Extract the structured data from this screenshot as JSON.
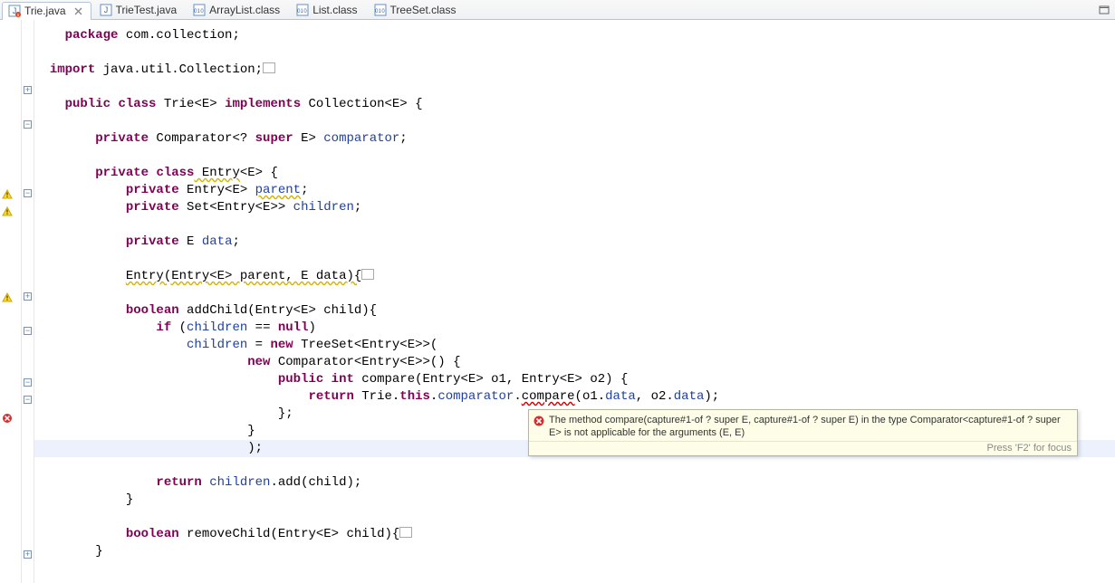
{
  "tabs": [
    {
      "label": "Trie.java",
      "icon": "java-error",
      "active": true
    },
    {
      "label": "TrieTest.java",
      "icon": "java",
      "active": false
    },
    {
      "label": "ArrayList.class",
      "icon": "class",
      "active": false
    },
    {
      "label": "List.class",
      "icon": "class",
      "active": false
    },
    {
      "label": "TreeSet.class",
      "icon": "class",
      "active": false
    }
  ],
  "hover": {
    "message": "The method compare(capture#1-of ? super E, capture#1-of ? super E) in the type Comparator<capture#1-of ? super E> is not applicable for the arguments (E, E)",
    "footer": "Press 'F2' for focus"
  },
  "code": {
    "l1_kw_package": "package",
    "l1_rest": " com.collection;",
    "l3_kw_import": "import",
    "l3_rest": " java.util.Collection;",
    "l5_kw_pub": "public",
    "l5_kw_cls": "class",
    "l5_name": " Trie<E> ",
    "l5_kw_impl": "implements",
    "l5_rest": " Collection<E> {",
    "l7_kw_priv": "private",
    "l7_rest1": " Comparator<? ",
    "l7_kw_sup": "super",
    "l7_rest2": " E> ",
    "l7_fld": "comparator",
    "l7_semi": ";",
    "l9_kw_priv": "private",
    "l9_kw_cls": "class",
    "l9_name": " Entry",
    "l9_rest": "<E> {",
    "l10_kw_priv": "private",
    "l10_rest": " Entry<E> ",
    "l10_fld": "parent",
    "l10_semi": ";",
    "l11_kw_priv": "private",
    "l11_rest": " Set<Entry<E>> ",
    "l11_fld": "children",
    "l11_semi": ";",
    "l13_kw_priv": "private",
    "l13_rest": " E ",
    "l13_fld": "data",
    "l13_semi": ";",
    "l15_name": "Entry",
    "l15_sig": "(Entry<E> parent, E data){",
    "l17_kw_bool": "boolean",
    "l17_rest": " addChild(Entry<E> child){",
    "l18_kw_if": "if",
    "l18_rest1": " (",
    "l18_fld": "children",
    "l18_rest2": " == ",
    "l18_kw_null": "null",
    "l18_rest3": ")",
    "l19_fld": "children",
    "l19_rest1": " = ",
    "l19_kw_new": "new",
    "l19_rest2": " TreeSet<Entry<E>>(",
    "l20_kw_new": "new",
    "l20_rest": " Comparator<Entry<E>>() {",
    "l21_kw_pub": "public",
    "l21_kw_int": "int",
    "l21_rest": " compare(Entry<E> o1, Entry<E> o2) {",
    "l22_kw_ret": "return",
    "l22_rest1": " Trie.",
    "l22_kw_this": "this",
    "l22_rest2": ".",
    "l22_fld1": "comparator",
    "l22_rest3": ".",
    "l22_err": "compare",
    "l22_rest4": "(o1.",
    "l22_fld2": "data",
    "l22_rest5": ", o2.",
    "l22_fld3": "data",
    "l22_rest6": ");",
    "l23": "};",
    "l24": "}",
    "l25": ");",
    "l27_kw_ret": "return",
    "l27_rest1": " ",
    "l27_fld": "children",
    "l27_rest2": ".add(child);",
    "l28": "}",
    "l30_kw_bool": "boolean",
    "l30_rest": " removeChild(Entry<E> child){",
    "l31": "}"
  }
}
